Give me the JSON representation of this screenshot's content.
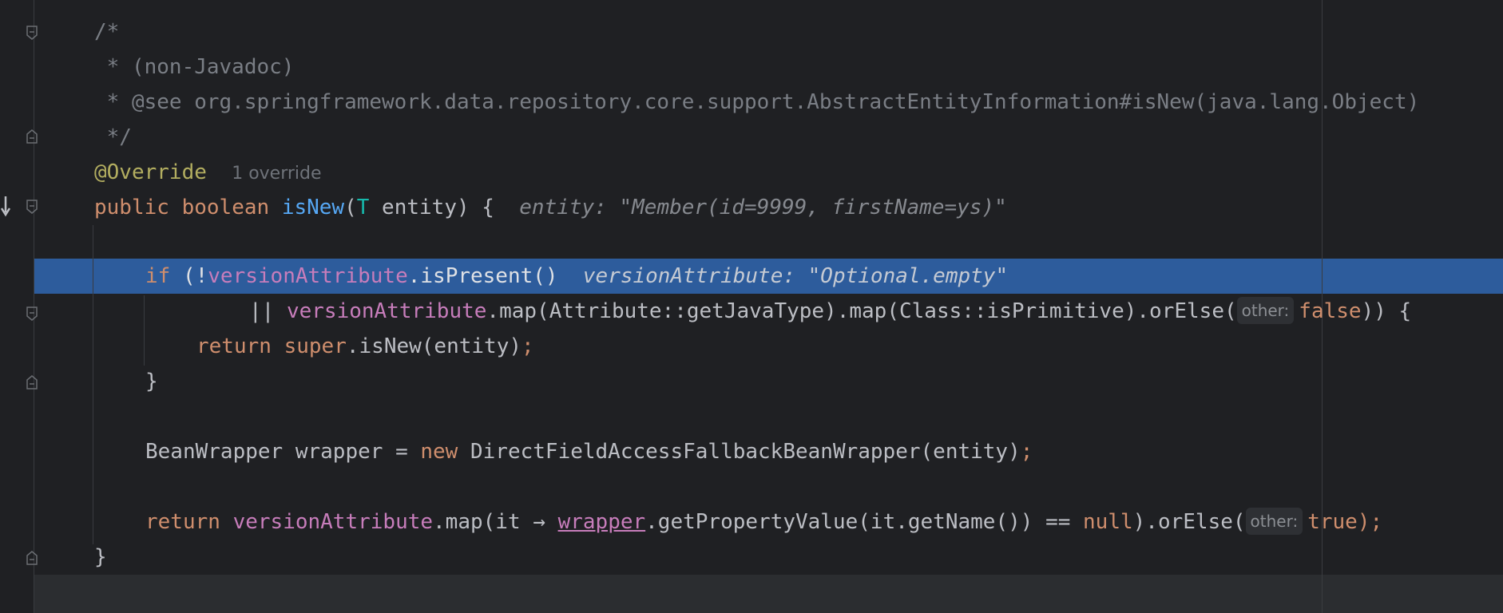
{
  "editor": {
    "code_lines": {
      "l1": "/*",
      "l2": " * (non-Javadoc)",
      "l3": " * @see org.springframework.data.repository.core.support.AbstractEntityInformation#isNew(java.lang.Object)",
      "l4": " */",
      "l5_annotation": "@Override",
      "l5_hint": "1 override",
      "l6_public": "public",
      "l6_boolean": "boolean",
      "l6_method": "isNew",
      "l6_paren_open": "(",
      "l6_type": "T",
      "l6_rest": " entity) {",
      "l6_inlay": "entity: \"Member(id=9999, firstName=ys)\"",
      "l8_if": "if",
      "l8_open": " (!",
      "l8_field": "versionAttribute",
      "l8_call": ".isPresent()",
      "l8_inlay": "versionAttribute: \"Optional.empty\"",
      "l9_or": "|| ",
      "l9_field": "versionAttribute",
      "l9_call": ".map(Attribute::getJavaType).map(Class::isPrimitive).orElse(",
      "l9_chip": "other:",
      "l9_false": "false",
      "l9_end": ")) {",
      "l10_return": "return",
      "l10_super": "super",
      "l10_call": ".isNew(entity)",
      "l10_semi": ";",
      "l11": "}",
      "l13_decl": "BeanWrapper wrapper = ",
      "l13_new": "new",
      "l13_ctor": " DirectFieldAccessFallbackBeanWrapper(entity)",
      "l13_semi": ";",
      "l15_return": "return",
      "l15_field": "versionAttribute",
      "l15_map": ".map(it → ",
      "l15_wrapper": "wrapper",
      "l15_call": ".getPropertyValue(it.getName()) == ",
      "l15_null": "null",
      "l15_orelse": ").orElse(",
      "l15_chip": "other:",
      "l15_true": "true",
      "l15_end": ");",
      "l16": "}"
    },
    "gutter_icons": {
      "fold": "fold-marker-icon",
      "execution": "execution-point-arrow-icon"
    },
    "colors": {
      "background": "#1f2023",
      "execution_highlight": "#2d5c9c",
      "keyword": "#cf8e6d",
      "annotation": "#b3ae60",
      "field": "#c77dbb",
      "comment": "#7a7e85"
    }
  }
}
